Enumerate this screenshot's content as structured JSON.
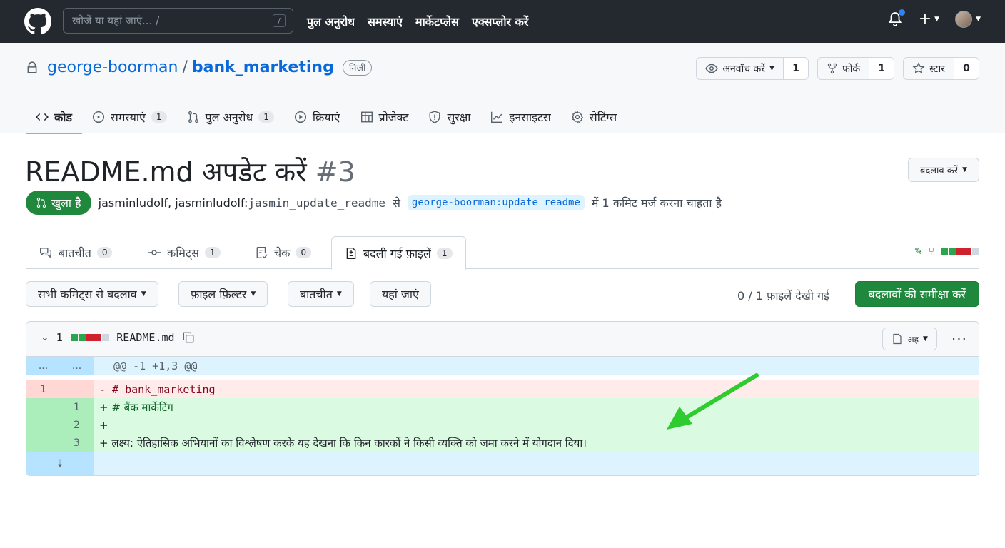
{
  "topnav": {
    "search_placeholder": "खोजें या यहां जाएं... /",
    "search_shortcut": "/",
    "links": [
      "पुल अनुरोध",
      "समस्याएं",
      "मार्केटप्लेस",
      "एक्सप्लोर करें"
    ]
  },
  "repo": {
    "owner": "george-boorman",
    "separator": "/",
    "name": "bank_marketing",
    "visibility": "निजी",
    "actions": {
      "watch_label": "अनवॉच करें",
      "watch_count": "1",
      "fork_label": "फोर्क",
      "fork_count": "1",
      "star_label": "स्टार",
      "star_count": "0"
    },
    "tabs": [
      {
        "label": "कोड",
        "count": ""
      },
      {
        "label": "समस्याएं",
        "count": "1"
      },
      {
        "label": "पुल अनुरोध",
        "count": "1"
      },
      {
        "label": "क्रियाएं",
        "count": ""
      },
      {
        "label": "प्रोजेक्ट",
        "count": ""
      },
      {
        "label": "सुरक्षा",
        "count": ""
      },
      {
        "label": "इनसाइटस",
        "count": ""
      },
      {
        "label": "सेटिंग्स",
        "count": ""
      }
    ]
  },
  "pr": {
    "title": "README.md अपडेट करें",
    "number": "#3",
    "edit_label": "बदलाव करें",
    "state": "खुला है",
    "author": "jasminludolf,",
    "author_prefix": "jasminludolf:",
    "head_branch": "jasmin_update_readme",
    "connector": "से",
    "base_branch": "george-boorman:update_readme",
    "merge_text": "में 1 कमिट मर्ज करना चाहता है",
    "tabs": [
      {
        "label": "बातचीत",
        "count": "0"
      },
      {
        "label": "कमिट्स",
        "count": "1"
      },
      {
        "label": "चेक",
        "count": "0"
      },
      {
        "label": "बदली गई फ़ाइलें",
        "count": "1"
      }
    ]
  },
  "toolbar": {
    "commits_filter": "सभी कमिट्स से बदलाव",
    "file_filter": "फ़ाइल फ़िल्टर",
    "conversations": "बातचीत",
    "jump_to": "यहां जाएं",
    "viewed_status": "0 / 1 फ़ाइलें देखी गई",
    "review_button": "बदलावों की समीक्षा करें"
  },
  "file": {
    "changes_count": "1",
    "filename": "README.md",
    "view_mode": "अह",
    "more": "···",
    "hunk": {
      "left": "...",
      "right": "...",
      "text": "@@ -1 +1,3 @@"
    },
    "lines": [
      {
        "type": "del",
        "old": "1",
        "new": "",
        "text": "- # bank_marketing"
      },
      {
        "type": "add",
        "old": "",
        "new": "1",
        "text": "+ # बैंक मार्केटिंग"
      },
      {
        "type": "add",
        "old": "",
        "new": "2",
        "text": "+"
      },
      {
        "type": "add",
        "old": "",
        "new": "3",
        "text": "+ लक्ष्य: ऐतिहासिक अभियानों का विश्लेषण करके यह देखना कि किन कारकों ने किसी व्यक्ति को जमा करने में योगदान दिया।"
      }
    ]
  },
  "colors": {
    "nav_bg": "#24292f",
    "accent_green": "#1f883d",
    "link_blue": "#0969da",
    "annotation_arrow": "#2ecc2e"
  }
}
